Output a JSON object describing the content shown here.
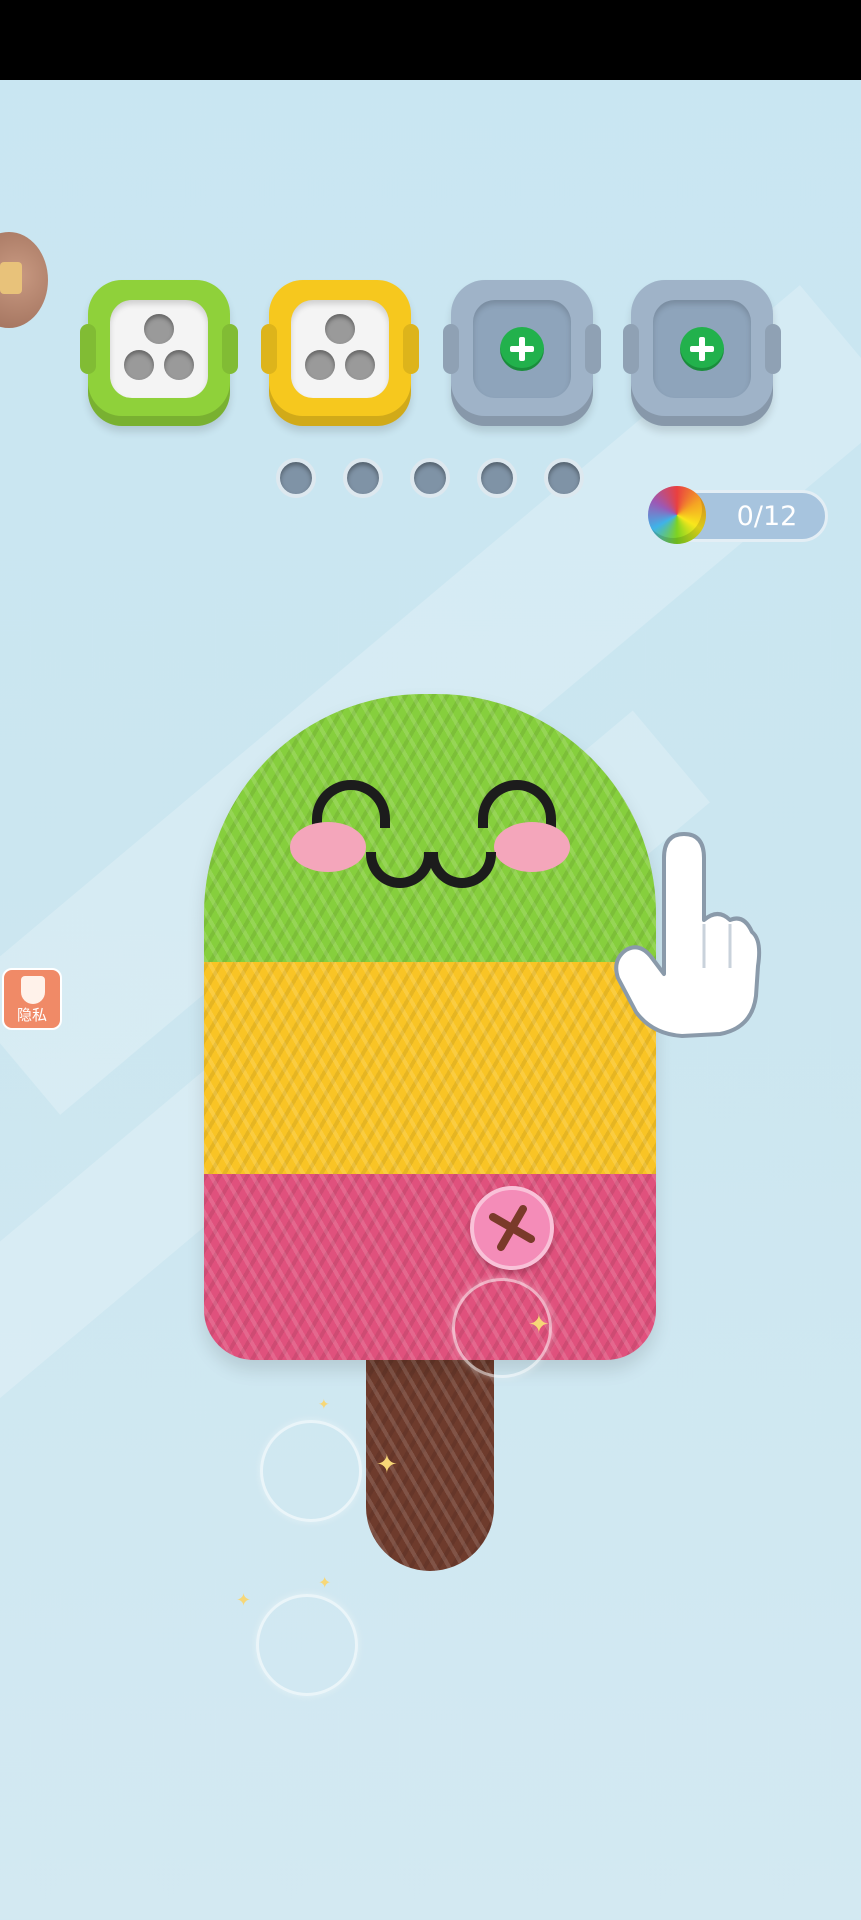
{
  "status_bar": {
    "color": "#000000"
  },
  "top_bar": {
    "chest_icon": "treasure-chest-icon",
    "slots": [
      {
        "id": "green",
        "state": "filled",
        "color": "#8fd13a",
        "holes": 3
      },
      {
        "id": "yellow",
        "state": "filled",
        "color": "#f6c81e",
        "holes": 3
      },
      {
        "id": "gray-1",
        "state": "locked",
        "color": "#9fb3c8",
        "icon": "plus-icon"
      },
      {
        "id": "gray-2",
        "state": "locked",
        "color": "#9fb3c8",
        "icon": "plus-icon"
      }
    ],
    "queue_dots": 5
  },
  "progress": {
    "label": "0/12",
    "icon": "rainbow-yarn-ball-icon",
    "current": 0,
    "total": 12
  },
  "privacy": {
    "label": "隐私",
    "icon": "shield-check-icon",
    "color": "#f08a67"
  },
  "popsicle": {
    "bands": [
      {
        "name": "green",
        "color": "#86cf3d"
      },
      {
        "name": "yellow",
        "color": "#f9c425"
      },
      {
        "name": "pink",
        "color": "#e0517d"
      }
    ],
    "stick_color": "#6e3b2c",
    "button_icon": "sewing-button-icon"
  },
  "tutorial": {
    "hand_icon": "pointing-hand-icon"
  }
}
